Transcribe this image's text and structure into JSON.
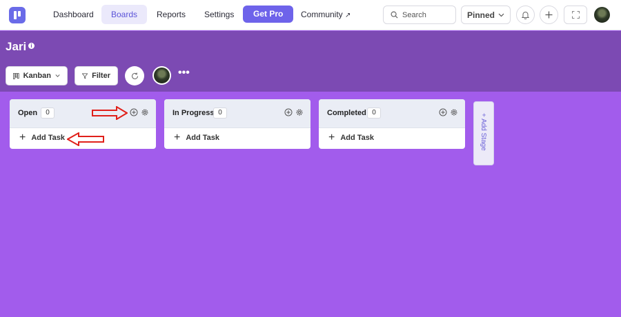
{
  "nav": {
    "links": [
      "Dashboard",
      "Boards",
      "Reports",
      "Settings"
    ],
    "get_pro": "Get Pro",
    "community": "Community",
    "search_placeholder": "Search",
    "pinned": "Pinned"
  },
  "board": {
    "title": "Jari",
    "view": "Kanban",
    "filter": "Filter"
  },
  "columns": [
    {
      "name": "Open",
      "count": "0",
      "add_task": "Add Task"
    },
    {
      "name": "In Progress",
      "count": "0",
      "add_task": "Add Task"
    },
    {
      "name": "Completed",
      "count": "0",
      "add_task": "Add Task"
    }
  ],
  "add_stage": "+ Add Stage",
  "colors": {
    "accent": "#6e63ea",
    "board_header": "#7c4ab3",
    "board_bg": "#a25cec",
    "annotation_arrow": "#e0201a"
  }
}
